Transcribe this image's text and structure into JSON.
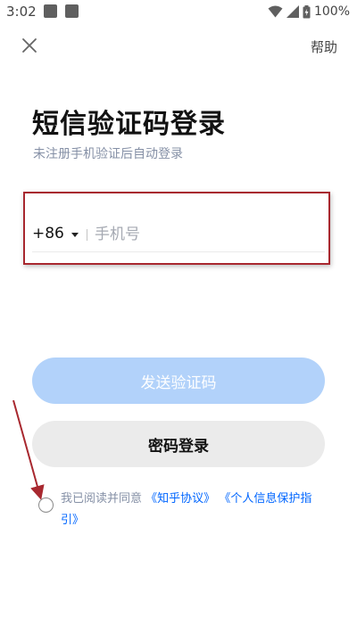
{
  "status_bar": {
    "time": "3:02",
    "battery": "100%"
  },
  "nav": {
    "close_icon": "close-icon",
    "help_label": "帮助"
  },
  "title": "短信验证码登录",
  "subtitle": "未注册手机验证后自动登录",
  "phone": {
    "country_code": "+86",
    "placeholder": "手机号",
    "value": ""
  },
  "buttons": {
    "send_code": "发送验证码",
    "password_login": "密码登录"
  },
  "agreement": {
    "prefix": "我已阅读并同意",
    "link1": "《知乎协议》",
    "link2": "《个人信息保护指引》"
  },
  "colors": {
    "primary_disabled": "#b2d2fa",
    "link": "#0066ff",
    "annotation": "#a8282f"
  }
}
